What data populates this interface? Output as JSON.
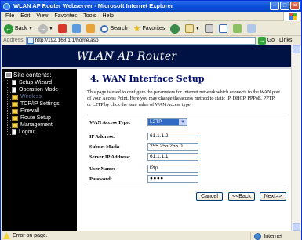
{
  "window": {
    "title": "WLAN AP Router Webserver - Microsoft Internet Explorer"
  },
  "menu": [
    "File",
    "Edit",
    "View",
    "Favorites",
    "Tools",
    "Help"
  ],
  "toolbar": {
    "back": "Back",
    "search": "Search",
    "favorites": "Favorites"
  },
  "address": {
    "label": "Address",
    "url": "http://192.168.1.1/home.asp",
    "go": "Go",
    "links": "Links"
  },
  "banner": {
    "title": "WLAN AP Router"
  },
  "sidebar": {
    "title": "Site contents:",
    "items": [
      {
        "label": "Setup Wizard",
        "icon": "doc-icon"
      },
      {
        "label": "Operation Mode",
        "icon": "doc-icon"
      },
      {
        "label": "Wireless",
        "icon": "folder-icon"
      },
      {
        "label": "TCP/IP Settings",
        "icon": "folder-icon"
      },
      {
        "label": "Firewall",
        "icon": "folder-icon"
      },
      {
        "label": "Route Setup",
        "icon": "folder-icon"
      },
      {
        "label": "Management",
        "icon": "folder-icon"
      },
      {
        "label": "Logout",
        "icon": "doc-icon"
      }
    ]
  },
  "page": {
    "heading": "4. WAN Interface Setup",
    "description": "This page is used to configure the parameters for Internet network which connects to the WAN port of your Access Point. Here you may change the access method to static IP, DHCP, PPPoE, PPTP, or L2TP by click the item value of WAN Access type."
  },
  "form": {
    "wan_type_label": "WAN Access Type:",
    "wan_type_value": "L2TP",
    "ip_label": "IP Address:",
    "ip_value": "61.1.1.2",
    "mask_label": "Subnet Mask:",
    "mask_value": "255.255.255.0",
    "server_label": "Server IP Address:",
    "server_value": "61.1.1.1",
    "user_label": "User Name:",
    "user_value": "l2tp",
    "pass_label": "Password:",
    "pass_value": "●●●●"
  },
  "buttons": {
    "cancel": "Cancel",
    "back": "<<Back",
    "next": "Next>>"
  },
  "status": {
    "left": "Error on page.",
    "zone": "Internet"
  }
}
